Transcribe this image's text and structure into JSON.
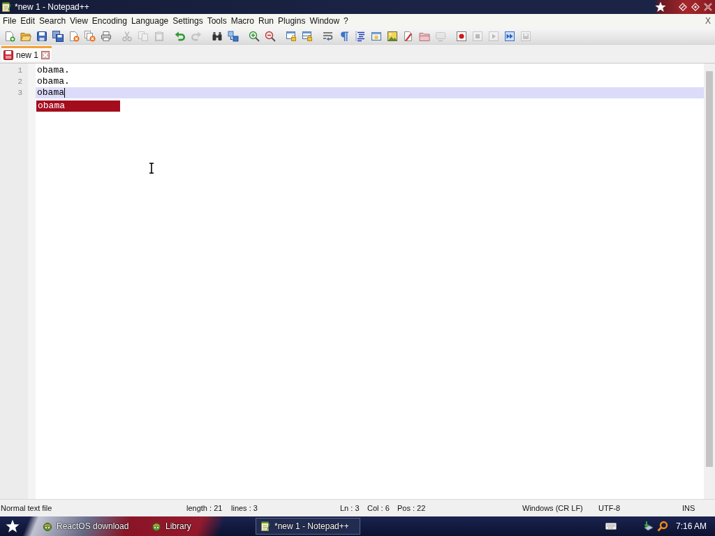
{
  "window": {
    "title": "*new 1 - Notepad++"
  },
  "menu": {
    "items": [
      "File",
      "Edit",
      "Search",
      "View",
      "Encoding",
      "Language",
      "Settings",
      "Tools",
      "Macro",
      "Run",
      "Plugins",
      "Window",
      "?"
    ],
    "close": "X"
  },
  "toolbar": {
    "groups": [
      [
        {
          "kind": "new",
          "disabled": false
        },
        {
          "kind": "open",
          "disabled": false
        },
        {
          "kind": "save",
          "disabled": false
        },
        {
          "kind": "save-all",
          "disabled": false
        },
        {
          "kind": "close",
          "disabled": false
        },
        {
          "kind": "close-all",
          "disabled": false
        },
        {
          "kind": "print",
          "disabled": false
        }
      ],
      [
        {
          "kind": "cut",
          "disabled": true
        },
        {
          "kind": "copy",
          "disabled": true
        },
        {
          "kind": "paste",
          "disabled": true
        }
      ],
      [
        {
          "kind": "undo",
          "disabled": false
        },
        {
          "kind": "redo",
          "disabled": true
        }
      ],
      [
        {
          "kind": "find",
          "disabled": false
        },
        {
          "kind": "replace",
          "disabled": false
        }
      ],
      [
        {
          "kind": "zoom-in",
          "disabled": false
        },
        {
          "kind": "zoom-out",
          "disabled": false
        }
      ],
      [
        {
          "kind": "sync-vertical",
          "disabled": false
        },
        {
          "kind": "sync-horizontal",
          "disabled": false
        }
      ],
      [
        {
          "kind": "word-wrap",
          "disabled": false
        },
        {
          "kind": "all-chars",
          "disabled": false
        },
        {
          "kind": "indent-guide",
          "disabled": false
        },
        {
          "kind": "user-language",
          "disabled": false
        },
        {
          "kind": "document-map",
          "disabled": false
        },
        {
          "kind": "function-list",
          "disabled": false
        },
        {
          "kind": "folder-workspace",
          "disabled": false
        },
        {
          "kind": "monitoring",
          "disabled": true
        }
      ],
      [
        {
          "kind": "record",
          "disabled": false
        },
        {
          "kind": "stop",
          "disabled": true
        },
        {
          "kind": "play",
          "disabled": true
        },
        {
          "kind": "play-multiple",
          "disabled": false
        },
        {
          "kind": "save-macro",
          "disabled": true
        }
      ]
    ]
  },
  "tabs": [
    {
      "label": "new 1",
      "selected": true,
      "unsaved": true
    }
  ],
  "editor": {
    "lines": [
      {
        "number": "1",
        "text": "obama.",
        "current": false
      },
      {
        "number": "2",
        "text": "obama.",
        "current": false
      },
      {
        "number": "3",
        "text": "obama",
        "current": true
      }
    ],
    "autocomplete": [
      {
        "text": "obama",
        "selected": true
      }
    ]
  },
  "status_bar": {
    "file_type": "Normal text file",
    "length": "length : 21",
    "lines": "lines : 3",
    "line": "Ln : 3",
    "column": "Col : 6",
    "position": "Pos : 22",
    "eol": "Windows (CR LF)",
    "encoding": "UTF-8",
    "mode": "INS"
  },
  "taskbar": {
    "items": [
      {
        "label": "ReactOS download",
        "kind": "app",
        "selected": false
      },
      {
        "label": "Library",
        "kind": "app",
        "selected": false
      },
      {
        "label": "*new 1 - Notepad++",
        "kind": "notepad",
        "selected": true
      }
    ],
    "clock": "7:16 AM"
  }
}
